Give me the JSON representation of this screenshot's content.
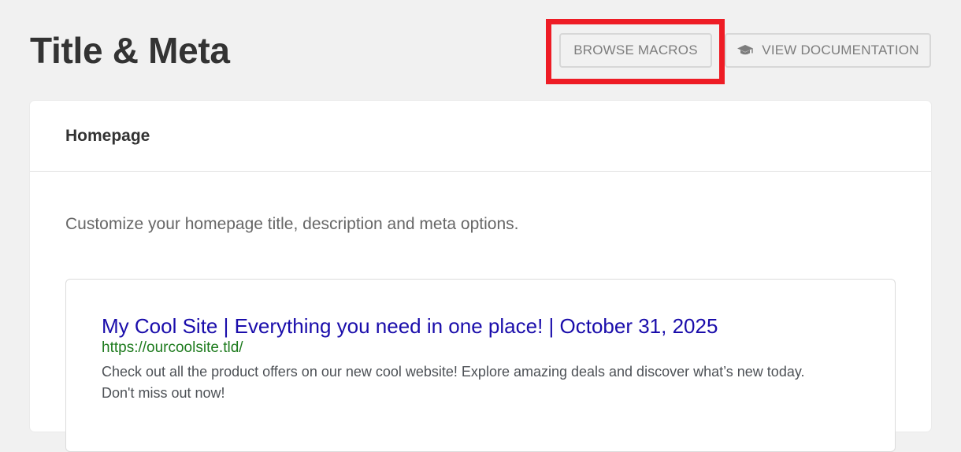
{
  "header": {
    "title": "Title & Meta",
    "browse_macros_label": "BROWSE MACROS",
    "view_docs_label": "VIEW DOCUMENTATION",
    "view_docs_icon": "graduation-cap-icon"
  },
  "homepage": {
    "section_title": "Homepage",
    "description": "Customize your homepage title, description and meta options.",
    "preview": {
      "title": "My Cool Site | Everything you need in one place! | October 31, 2025",
      "url": "https://ourcoolsite.tld/",
      "description": "Check out all the product offers on our new cool website! Explore amazing deals and discover what’s new today. Don't miss out now!"
    }
  },
  "colors": {
    "highlight": "#ee1c25",
    "serp_title": "#1a0dab",
    "serp_url": "#1e7b1e",
    "page_background": "#f1f1f1"
  }
}
